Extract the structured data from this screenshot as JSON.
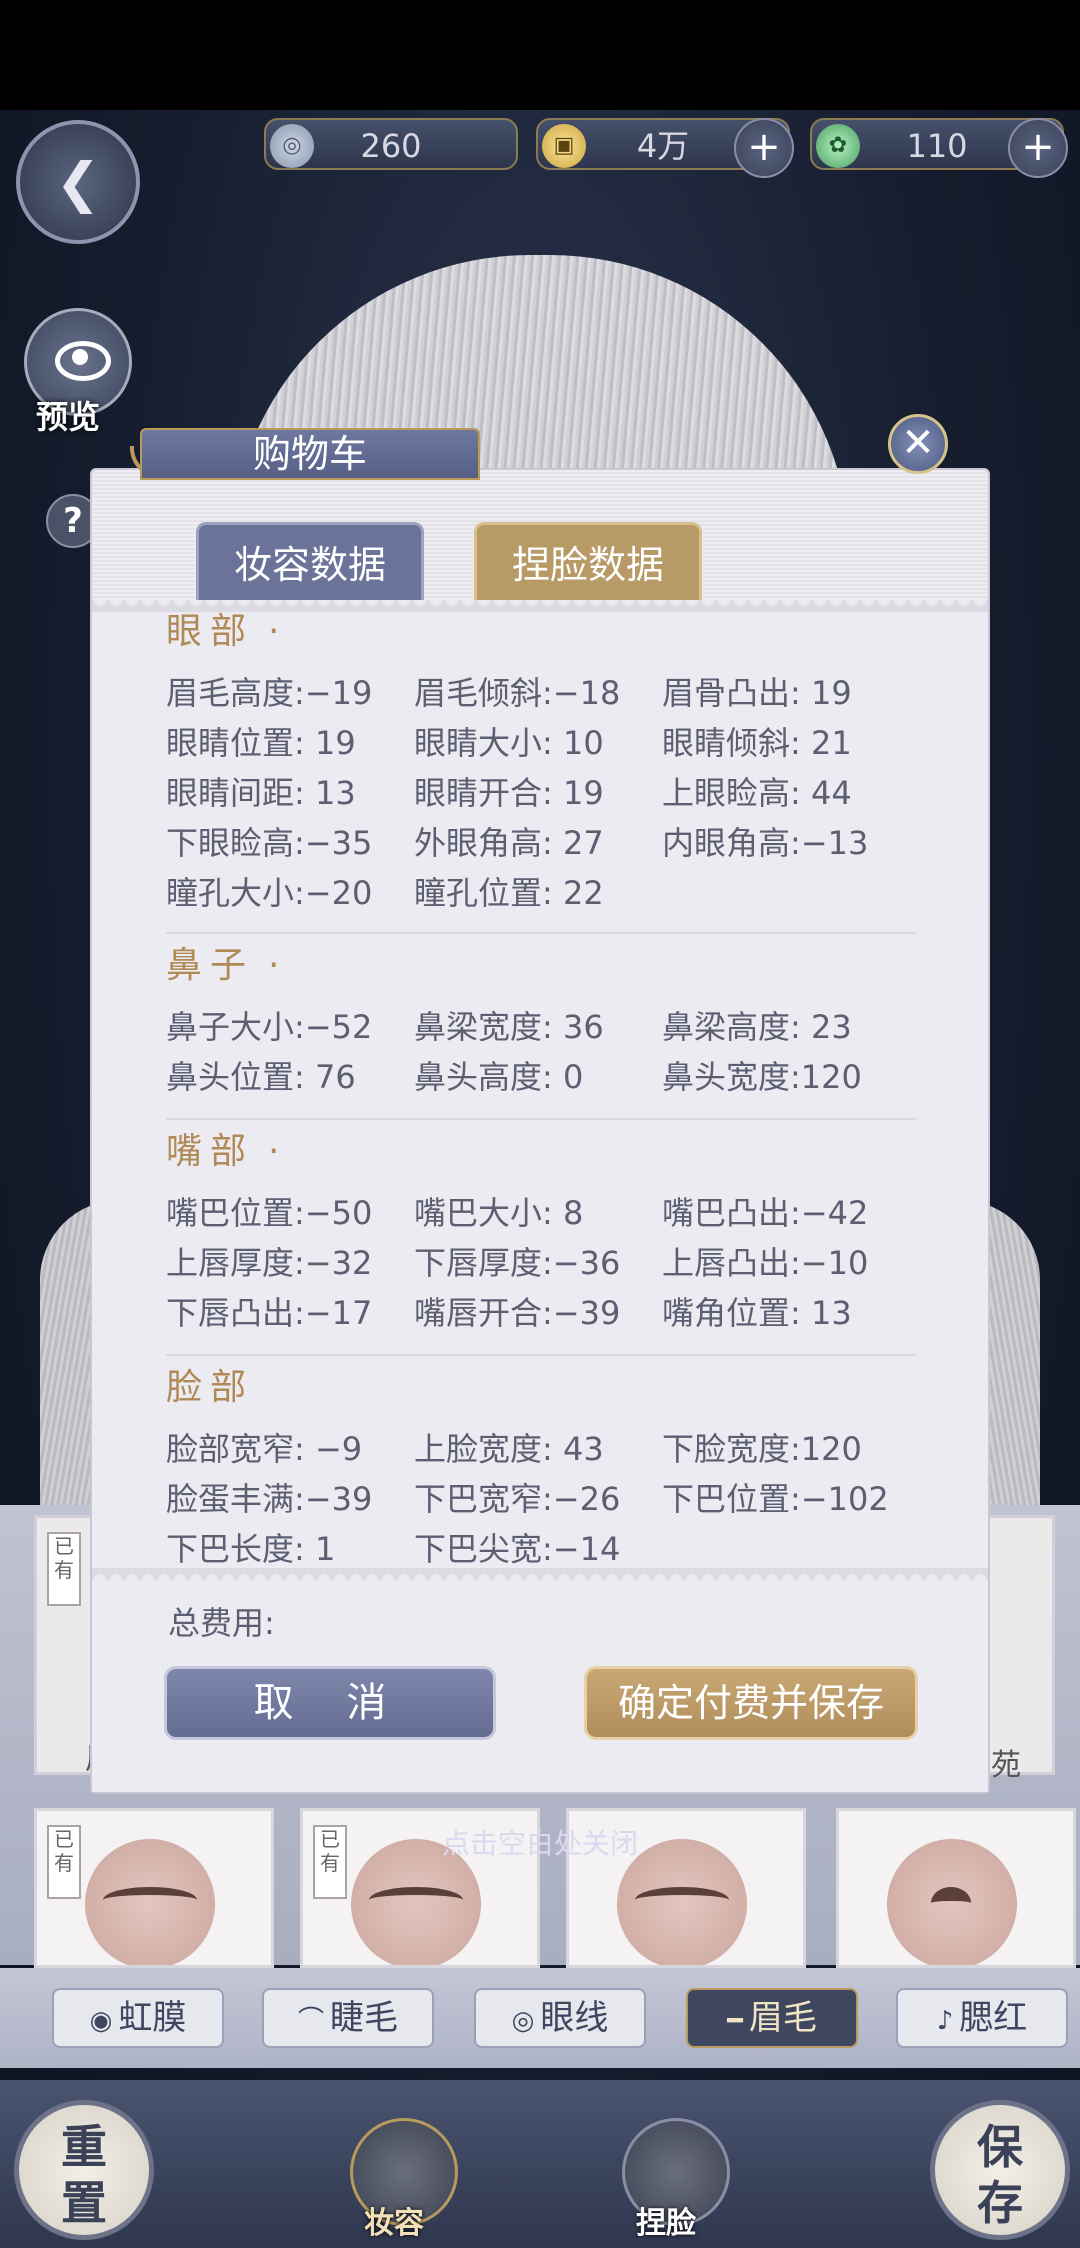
{
  "topbar": {
    "currency1": {
      "icon": "silver-coin-icon",
      "value": "260"
    },
    "currency2": {
      "icon": "gold-coin-icon",
      "value": "4万"
    },
    "currency3": {
      "icon": "jade-dragon-icon",
      "value": "110"
    }
  },
  "left_controls": {
    "preview_label": "预览",
    "help_label": "?"
  },
  "modal": {
    "title": "购物车",
    "tabs": [
      {
        "label": "妆容数据",
        "active": false
      },
      {
        "label": "捏脸数据",
        "active": true
      }
    ],
    "sections": [
      {
        "name": "眼部",
        "dot": "·",
        "items": [
          "眉毛高度:−19",
          "眉毛倾斜:−18",
          "眉骨凸出: 19",
          "眼睛位置: 19",
          "眼睛大小: 10",
          "眼睛倾斜: 21",
          "眼睛间距: 13",
          "眼睛开合: 19",
          "上眼睑高: 44",
          "下眼睑高:−35",
          "外眼角高: 27",
          "内眼角高:−13",
          "瞳孔大小:−20",
          "瞳孔位置: 22"
        ]
      },
      {
        "name": "鼻子",
        "dot": "·",
        "items": [
          "鼻子大小:−52",
          "鼻梁宽度: 36",
          "鼻梁高度: 23",
          "鼻头位置: 76",
          "鼻头高度:  0",
          "鼻头宽度:120"
        ]
      },
      {
        "name": "嘴部",
        "dot": "·",
        "items": [
          "嘴巴位置:−50",
          "嘴巴大小:  8",
          "嘴巴凸出:−42",
          "上唇厚度:−32",
          "下唇厚度:−36",
          "上唇凸出:−10",
          "下唇凸出:−17",
          "嘴唇开合:−39",
          "嘴角位置: 13"
        ]
      },
      {
        "name": "脸部",
        "dot": "",
        "items": [
          "脸部宽窄: −9",
          "上脸宽度: 43",
          "下脸宽度:120",
          "脸蛋丰满:−39",
          "下巴宽窄:−26",
          "下巴位置:−102",
          "下巴长度:  1",
          "下巴尖宽:−14"
        ]
      }
    ],
    "total_label": "总费用:",
    "cancel_label": "取 消",
    "confirm_label": "确定付费并保存"
  },
  "close_hint": "点击空白处关闭",
  "background_cards": {
    "owned_tag": "已有",
    "partial_left": "眉",
    "partial_right": "苑"
  },
  "categories": [
    {
      "label": "虹膜",
      "glyph": "◉",
      "active": false
    },
    {
      "label": "睫毛",
      "glyph": "⌒",
      "active": false
    },
    {
      "label": "眼线",
      "glyph": "◎",
      "active": false
    },
    {
      "label": "眉毛",
      "glyph": "━",
      "active": true
    },
    {
      "label": "腮红",
      "glyph": "♪",
      "active": false
    }
  ],
  "bottom_nav": {
    "reset_label": "重置",
    "makeup_label": "妆容",
    "face_label": "捏脸",
    "save_label": "保存"
  }
}
